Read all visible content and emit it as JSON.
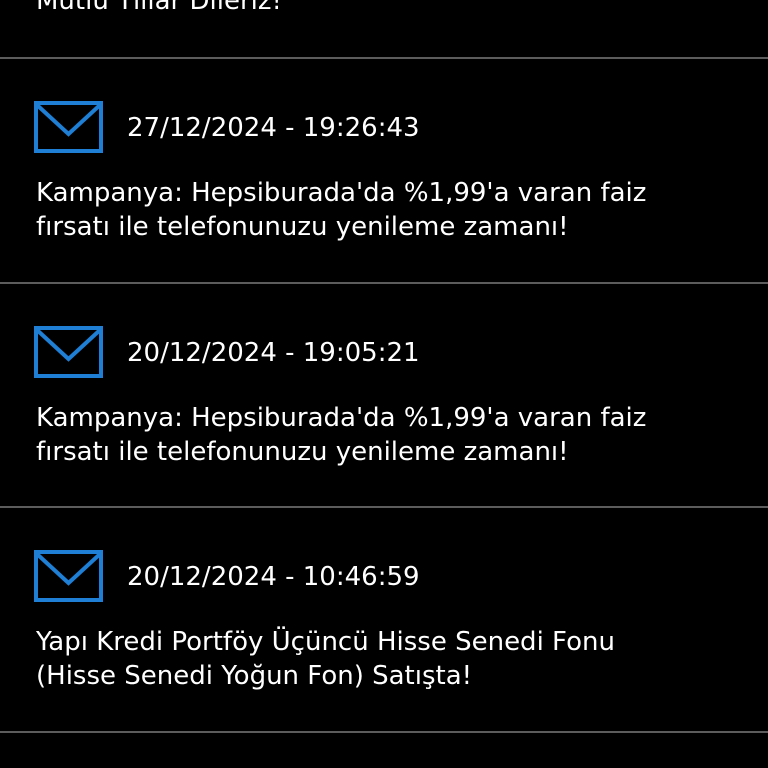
{
  "accent_color": "#1e7fd4",
  "partial_message": {
    "text": "Mutlu Yıllar Dileriz!"
  },
  "messages": [
    {
      "timestamp": "27/12/2024 - 19:26:43",
      "lines": [
        "Kampanya: Hepsiburada'da %1,99'a varan faiz",
        "fırsatı ile telefonunuzu yenileme zamanı!"
      ],
      "icon": "envelope-icon"
    },
    {
      "timestamp": "20/12/2024 - 19:05:21",
      "lines": [
        "Kampanya: Hepsiburada'da %1,99'a varan faiz",
        "fırsatı ile telefonunuzu yenileme zamanı!"
      ],
      "icon": "envelope-icon"
    },
    {
      "timestamp": "20/12/2024 - 10:46:59",
      "lines": [
        "Yapı Kredi Portföy Üçüncü Hisse Senedi Fonu",
        "(Hisse Senedi Yoğun Fon) Satışta!"
      ],
      "icon": "envelope-icon"
    }
  ]
}
